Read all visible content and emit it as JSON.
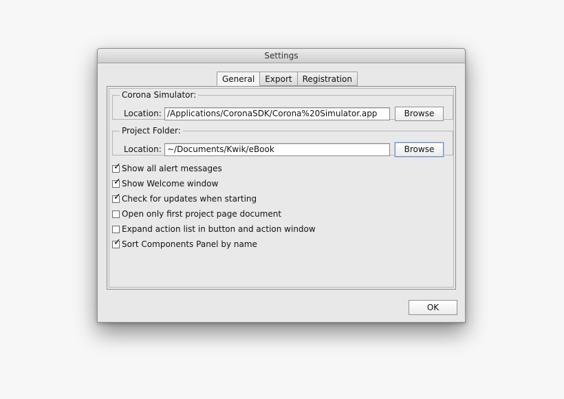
{
  "window": {
    "title": "Settings"
  },
  "tabs": [
    {
      "label": "General",
      "active": true
    },
    {
      "label": "Export",
      "active": false
    },
    {
      "label": "Registration",
      "active": false
    }
  ],
  "corona_simulator": {
    "legend": "Corona Simulator:",
    "location_label": "Location:",
    "path": "/Applications/CoronaSDK/Corona%20Simulator.app",
    "browse_label": "Browse"
  },
  "project_folder": {
    "legend": "Project Folder:",
    "location_label": "Location:",
    "path": "~/Documents/Kwik/eBook",
    "browse_label": "Browse"
  },
  "options": [
    {
      "label": "Show all alert messages",
      "checked": true
    },
    {
      "label": "Show Welcome window",
      "checked": true
    },
    {
      "label": "Check for updates when starting",
      "checked": true
    },
    {
      "label": "Open only first project page document",
      "checked": false
    },
    {
      "label": "Expand action list in button and action window",
      "checked": false
    },
    {
      "label": "Sort Components Panel by name",
      "checked": true
    }
  ],
  "footer": {
    "ok_label": "OK"
  },
  "icons": {
    "checkmark": "checkmark-icon"
  }
}
